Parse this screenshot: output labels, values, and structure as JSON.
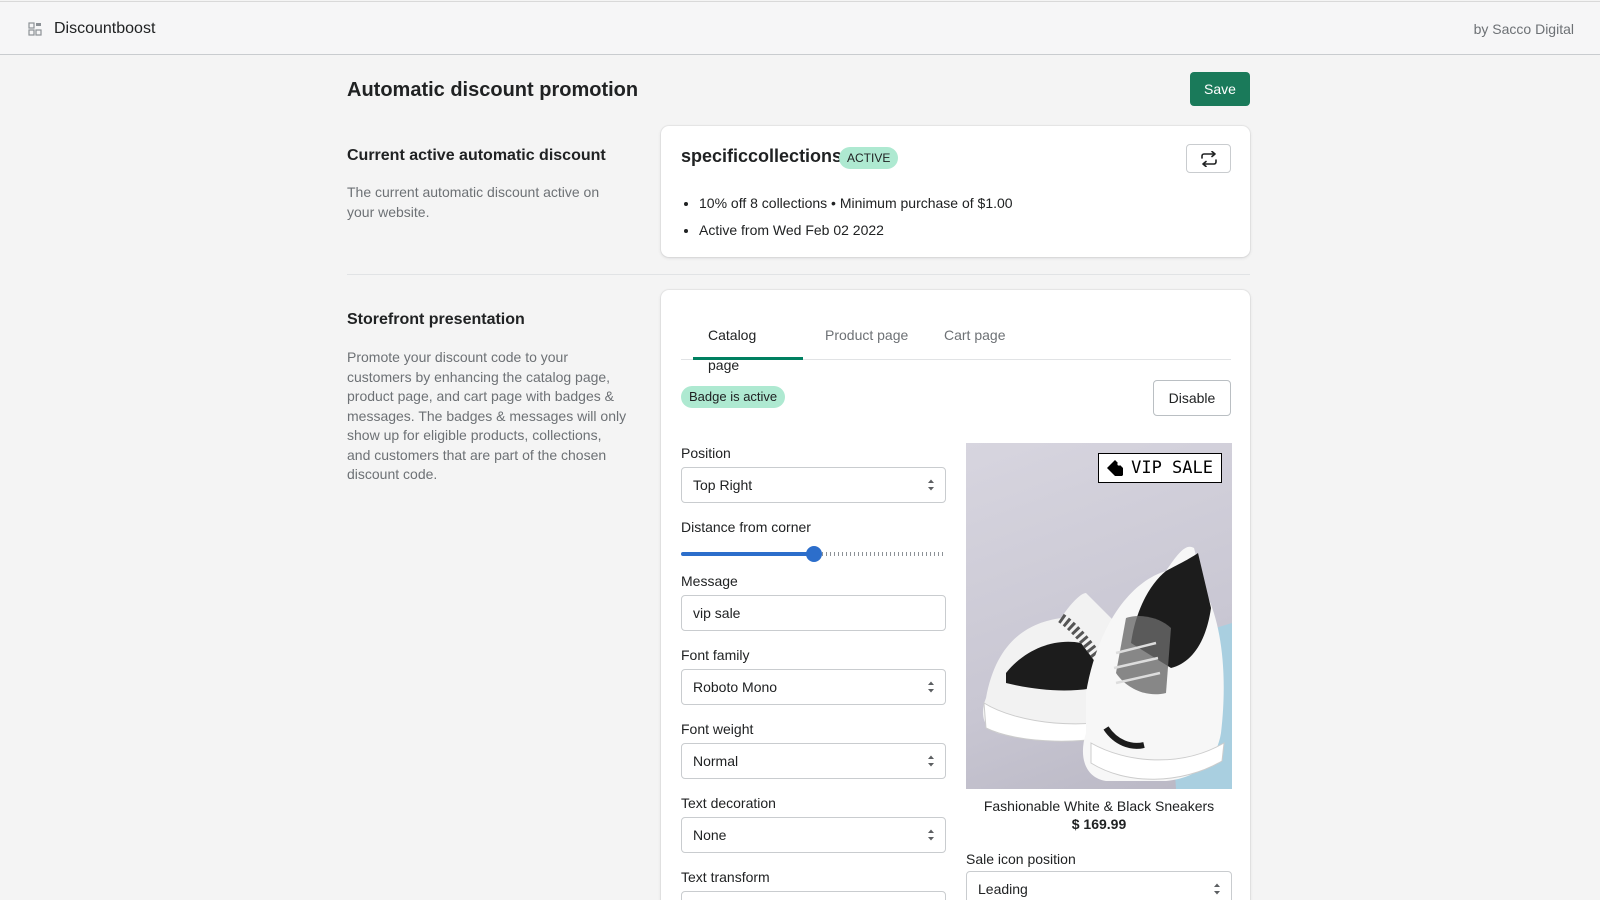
{
  "header": {
    "app_name": "Discountboost",
    "byline": "by Sacco Digital"
  },
  "page": {
    "title": "Automatic discount promotion",
    "save_label": "Save"
  },
  "current_discount": {
    "section_title": "Current active automatic discount",
    "section_desc": "The current automatic discount active on your website.",
    "name": "specificcollections",
    "status": "ACTIVE",
    "details": [
      "10% off 8 collections • Minimum purchase of $1.00",
      "Active from Wed Feb 02 2022"
    ]
  },
  "storefront": {
    "section_title": "Storefront presentation",
    "section_desc": "Promote your discount code to your customers by enhancing the catalog page, product page, and cart page with badges & messages. The badges & messages will only show up for eligible products, collections, and customers that are part of the chosen discount code.",
    "tabs": [
      "Catalog page",
      "Product page",
      "Cart page"
    ],
    "active_tab": "Catalog page",
    "badge_status": "Badge is active",
    "disable_label": "Disable",
    "fields": {
      "position": {
        "label": "Position",
        "value": "Top Right"
      },
      "distance": {
        "label": "Distance from corner",
        "fraction": 0.5
      },
      "message": {
        "label": "Message",
        "value": "vip sale"
      },
      "font_family": {
        "label": "Font family",
        "value": "Roboto Mono"
      },
      "font_weight": {
        "label": "Font weight",
        "value": "Normal"
      },
      "text_decoration": {
        "label": "Text decoration",
        "value": "None"
      },
      "text_transform": {
        "label": "Text transform"
      }
    },
    "preview": {
      "badge_text": "VIP SALE",
      "product_name": "Fashionable White & Black Sneakers",
      "price": "$ 169.99",
      "sale_icon_label": "Sale icon position",
      "sale_icon_value": "Leading"
    }
  },
  "colors": {
    "primary": "#1a7a5a",
    "active_badge": "#aee9d1",
    "slider": "#2c6ecb"
  }
}
